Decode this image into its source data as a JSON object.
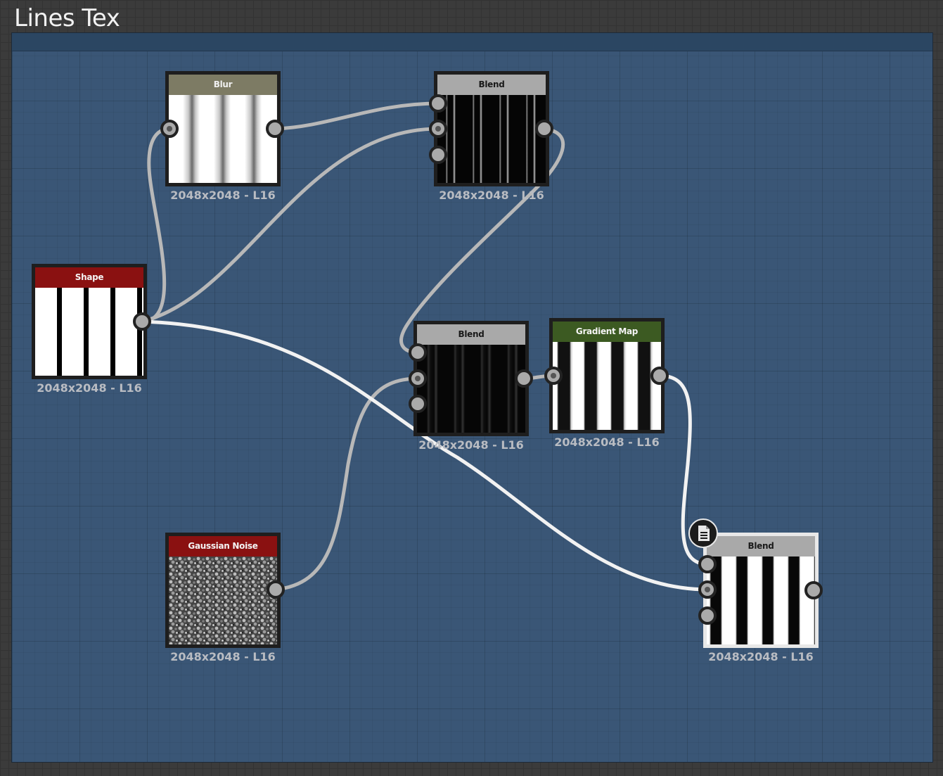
{
  "frame": {
    "title": "Lines Tex"
  },
  "nodes": {
    "blur": {
      "title": "Blur",
      "resolution": "2048x2048 - L16"
    },
    "blend_top": {
      "title": "Blend",
      "resolution": "2048x2048 - L16"
    },
    "shape": {
      "title": "Shape",
      "resolution": "2048x2048 - L16"
    },
    "blend_mid": {
      "title": "Blend",
      "resolution": "2048x2048 - L16"
    },
    "gradient_map": {
      "title": "Gradient Map",
      "resolution": "2048x2048 - L16"
    },
    "gaussian_noise": {
      "title": "Gaussian Noise",
      "resolution": "2048x2048 - L16"
    },
    "blend_output": {
      "title": "Blend",
      "resolution": "2048x2048 - L16"
    }
  },
  "colors": {
    "frame_background": "#3a5676",
    "wire": "#b8b8b8",
    "wire_selected": "#f2f2f2",
    "shape_header": "#8a1111",
    "noise_header": "#8a1111",
    "blur_header": "#7d7b64",
    "gradient_header": "#3c5a22",
    "blend_header": "#a9a9a9"
  },
  "icons": {
    "output_badge": "document-icon"
  }
}
